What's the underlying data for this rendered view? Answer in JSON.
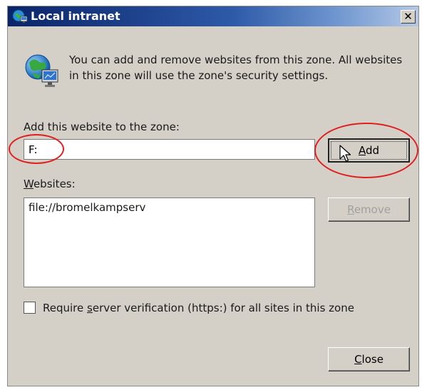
{
  "window": {
    "title": "Local intranet",
    "close_glyph": "✕"
  },
  "info": {
    "text": "You can add and remove websites from this zone. All websites in this zone will use the zone's security settings."
  },
  "add_section": {
    "label": "Add this website to the zone:",
    "input_value": "F:",
    "add_button": {
      "before": "",
      "mnemonic": "A",
      "after": "dd"
    }
  },
  "websites": {
    "label": {
      "before": "",
      "mnemonic": "W",
      "after": "ebsites:"
    },
    "items": [
      "file://bromelkampserv"
    ],
    "remove_button": {
      "before": "",
      "mnemonic": "R",
      "after": "emove"
    }
  },
  "options": {
    "require_https": {
      "checked": false,
      "label": {
        "before": "Require ",
        "mnemonic": "s",
        "after": "erver verification (https:) for all sites in this zone"
      }
    }
  },
  "footer": {
    "close_button": {
      "before": "",
      "mnemonic": "C",
      "after": "lose"
    }
  },
  "colors": {
    "title_gradient_start": "#0a246a",
    "title_gradient_end": "#b4c8e6",
    "dialog_bg": "#d4d0c8",
    "annotation_red": "#e02020"
  },
  "icons": {
    "title": "intranet-globe-icon",
    "info": "intranet-globe-monitor-icon",
    "close": "close-icon",
    "cursor": "mouse-pointer-icon"
  }
}
